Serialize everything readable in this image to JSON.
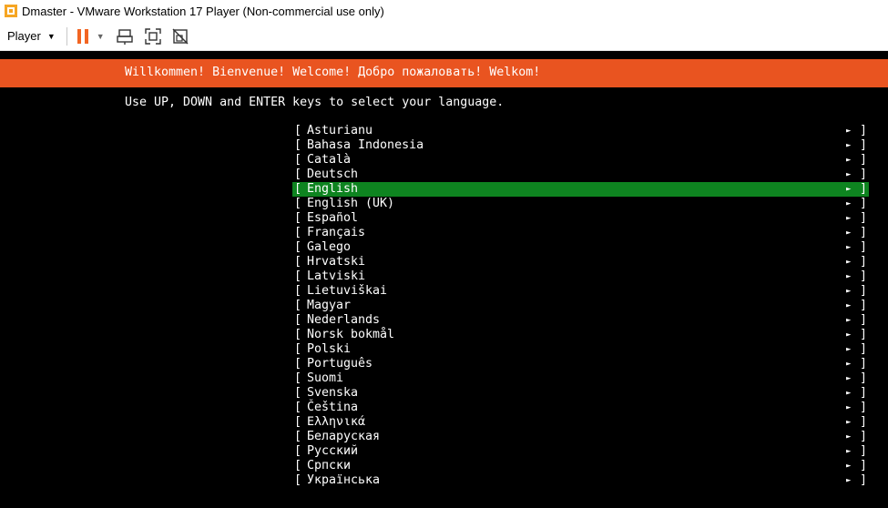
{
  "window": {
    "title": "Dmaster - VMware Workstation 17 Player (Non-commercial use only)"
  },
  "toolbar": {
    "player_label": "Player",
    "icons": [
      "pause-icon",
      "send-keys-icon",
      "fullscreen-icon",
      "unity-icon"
    ]
  },
  "console": {
    "banner": "Willkommen! Bienvenue! Welcome! Добро пожаловать! Welkom!",
    "instruction": "Use UP, DOWN and ENTER keys to select your language.",
    "bracket_open": "[",
    "bracket_close": "]",
    "arrow": "►",
    "selected_index": 4,
    "languages": [
      "Asturianu",
      "Bahasa Indonesia",
      "Català",
      "Deutsch",
      "English",
      "English (UK)",
      "Español",
      "Français",
      "Galego",
      "Hrvatski",
      "Latviski",
      "Lietuviškai",
      "Magyar",
      "Nederlands",
      "Norsk bokmål",
      "Polski",
      "Português",
      "Suomi",
      "Svenska",
      "Čeština",
      "Ελληνικά",
      "Беларуская",
      "Русский",
      "Српски",
      "Українська"
    ]
  },
  "colors": {
    "banner": "#e95420",
    "selected": "#0e8420",
    "console_bg": "#000000",
    "pause_orange": "#f26522"
  }
}
